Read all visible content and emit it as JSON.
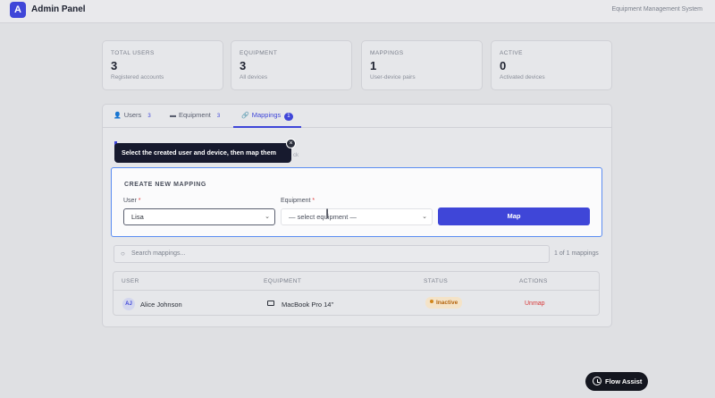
{
  "header": {
    "logo_letter": "A",
    "title": "Admin Panel",
    "subtitle": "Equipment Management System"
  },
  "stats": [
    {
      "label": "TOTAL USERS",
      "value": "3",
      "sub": "Registered accounts"
    },
    {
      "label": "EQUIPMENT",
      "value": "3",
      "sub": "All devices"
    },
    {
      "label": "MAPPINGS",
      "value": "1",
      "sub": "User-device pairs"
    },
    {
      "label": "ACTIVE",
      "value": "0",
      "sub": "Activated devices"
    }
  ],
  "tabs": [
    {
      "label": "Users",
      "badge": "3",
      "icon": "user-icon"
    },
    {
      "label": "Equipment",
      "badge": "3",
      "icon": "monitor-icon"
    },
    {
      "label": "Mappings",
      "badge": "1",
      "icon": "link-icon",
      "active": true
    }
  ],
  "tooltip": {
    "text": "Select the created user and device, then map them",
    "close": "×",
    "behind_text": "ck"
  },
  "create_mapping": {
    "title": "CREATE NEW MAPPING",
    "user_label": "User",
    "equipment_label": "Equipment",
    "required_mark": "*",
    "user_value": "Lisa",
    "equipment_value": "— select equipment —",
    "map_button": "Map"
  },
  "search": {
    "placeholder": "Search mappings...",
    "count": "1 of 1 mappings"
  },
  "table": {
    "columns": [
      "USER",
      "EQUIPMENT",
      "STATUS",
      "ACTIONS"
    ],
    "rows": [
      {
        "initials": "AJ",
        "user": "Alice Johnson",
        "equipment": "MacBook Pro 14\"",
        "status": "Inactive",
        "action": "Unmap"
      }
    ]
  },
  "flow_assist": {
    "label": "Flow Assist"
  },
  "colors": {
    "accent": "#3f46d8",
    "danger": "#d83838",
    "warning": "#b4650f"
  }
}
